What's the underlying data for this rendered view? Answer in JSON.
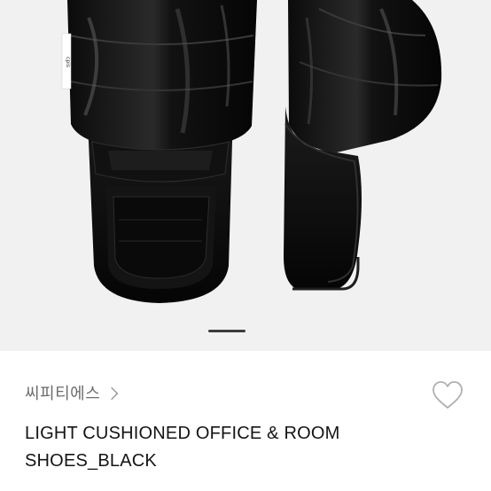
{
  "gallery": {
    "active_slide": 1,
    "tag_text": "cpis"
  },
  "brand": {
    "name": "씨피티에스"
  },
  "product": {
    "title": "LIGHT CUSHIONED OFFICE & ROOM SHOES_BLACK"
  },
  "icons": {
    "brand_link": "chevron-right-icon",
    "wishlist": "heart-outline-icon"
  },
  "colors": {
    "image_background": "#f1f1f1",
    "title_text": "#141414",
    "brand_text": "#6b6b6b"
  }
}
